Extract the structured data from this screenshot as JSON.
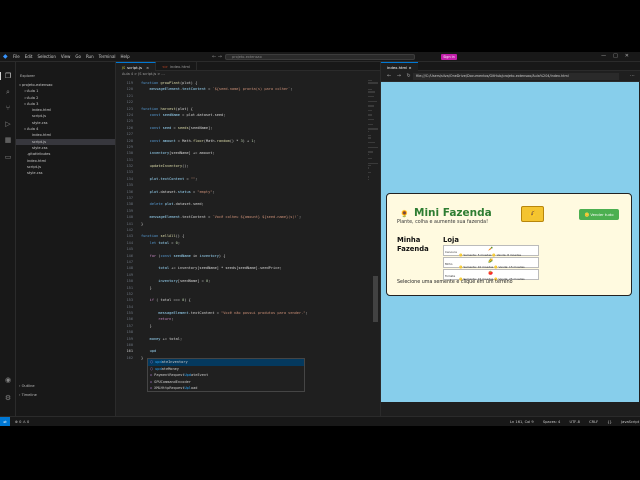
{
  "menubar": {
    "logo": "vscode-logo",
    "items": [
      "File",
      "Edit",
      "Selection",
      "View",
      "Go",
      "Run",
      "Terminal",
      "Help"
    ],
    "search_placeholder": "projeto-extensao",
    "signin": "Sign in"
  },
  "sidebar": {
    "title": "Explorer",
    "tree": [
      {
        "label": "projeto-extensao",
        "level": 0,
        "twisty": "v"
      },
      {
        "label": "Aula 1",
        "level": 1,
        "twisty": ">"
      },
      {
        "label": "Aula 2",
        "level": 1,
        "twisty": ">"
      },
      {
        "label": "Aula 3",
        "level": 1,
        "twisty": "v"
      },
      {
        "label": "index.html",
        "level": 2,
        "twisty": ""
      },
      {
        "label": "script.js",
        "level": 2,
        "twisty": ""
      },
      {
        "label": "style.css",
        "level": 2,
        "twisty": ""
      },
      {
        "label": "Aula 4",
        "level": 1,
        "twisty": "v"
      },
      {
        "label": "index.html",
        "level": 2,
        "twisty": ""
      },
      {
        "label": "script.js",
        "level": 2,
        "twisty": "",
        "selected": true
      },
      {
        "label": "style.css",
        "level": 2,
        "twisty": ""
      },
      {
        "label": ".gitattributes",
        "level": 1,
        "twisty": ""
      },
      {
        "label": "index.html",
        "level": 1,
        "twisty": ""
      },
      {
        "label": "script.js",
        "level": 1,
        "twisty": ""
      },
      {
        "label": "style.css",
        "level": 1,
        "twisty": ""
      }
    ],
    "outline": "Outline",
    "timeline": "Timeline"
  },
  "editor": {
    "tabs": [
      {
        "label": "script.js",
        "icon": "JS",
        "active": true
      },
      {
        "label": "index.html",
        "icon": "<>",
        "active": false
      }
    ],
    "breadcrumb": "Aula 4 > JS script.js > ...",
    "lines": [
      {
        "n": "119",
        "parts": [
          [
            "kw",
            "function "
          ],
          [
            "fn",
            "growPlant"
          ],
          [
            "tx",
            "(plot) {"
          ]
        ]
      },
      {
        "n": "120",
        "parts": [
          [
            "va",
            "    messageElement"
          ],
          [
            "tx",
            "."
          ],
          [
            "va",
            "textContent"
          ],
          [
            "tx",
            " = "
          ],
          [
            "st",
            "`${seed.name} pronta(s) para colher`"
          ],
          [
            "tx",
            ";"
          ]
        ]
      },
      {
        "n": "121",
        "parts": [
          [
            "tx",
            ""
          ]
        ]
      },
      {
        "n": "122",
        "parts": [
          [
            "tx",
            ""
          ]
        ]
      },
      {
        "n": "123",
        "parts": [
          [
            "kw",
            "function "
          ],
          [
            "fn",
            "harvest"
          ],
          [
            "tx",
            "(plot) {"
          ]
        ]
      },
      {
        "n": "124",
        "parts": [
          [
            "kw",
            "    const "
          ],
          [
            "va",
            "seedName"
          ],
          [
            "tx",
            " = plot.dataset.seed;"
          ]
        ]
      },
      {
        "n": "125",
        "parts": [
          [
            "tx",
            ""
          ]
        ]
      },
      {
        "n": "126",
        "parts": [
          [
            "kw",
            "    const "
          ],
          [
            "va",
            "seed"
          ],
          [
            "tx",
            " = "
          ],
          [
            "fn",
            "seeds"
          ],
          [
            "tx",
            "[seedName];"
          ]
        ]
      },
      {
        "n": "127",
        "parts": [
          [
            "tx",
            ""
          ]
        ]
      },
      {
        "n": "128",
        "parts": [
          [
            "kw",
            "    const "
          ],
          [
            "va",
            "amount"
          ],
          [
            "tx",
            " = Math."
          ],
          [
            "fn",
            "floor"
          ],
          [
            "tx",
            "(Math."
          ],
          [
            "fn",
            "random"
          ],
          [
            "tx",
            "() * "
          ],
          [
            "nu",
            "3"
          ],
          [
            "tx",
            ") + "
          ],
          [
            "nu",
            "1"
          ],
          [
            "tx",
            ";"
          ]
        ]
      },
      {
        "n": "129",
        "parts": [
          [
            "tx",
            ""
          ]
        ]
      },
      {
        "n": "130",
        "parts": [
          [
            "va",
            "    inventory"
          ],
          [
            "tx",
            "[seedName] += amount;"
          ]
        ]
      },
      {
        "n": "131",
        "parts": [
          [
            "tx",
            ""
          ]
        ]
      },
      {
        "n": "132",
        "parts": [
          [
            "fn",
            "    updateInventory"
          ],
          [
            "tx",
            "();"
          ]
        ]
      },
      {
        "n": "133",
        "parts": [
          [
            "tx",
            ""
          ]
        ]
      },
      {
        "n": "134",
        "parts": [
          [
            "va",
            "    plot"
          ],
          [
            "tx",
            "."
          ],
          [
            "va",
            "textContent"
          ],
          [
            "tx",
            " = "
          ],
          [
            "st",
            "\"\""
          ],
          [
            "tx",
            ";"
          ]
        ]
      },
      {
        "n": "135",
        "parts": [
          [
            "tx",
            ""
          ]
        ]
      },
      {
        "n": "136",
        "parts": [
          [
            "va",
            "    plot"
          ],
          [
            "tx",
            ".dataset."
          ],
          [
            "va",
            "status"
          ],
          [
            "tx",
            " = "
          ],
          [
            "st",
            "\"empty\""
          ],
          [
            "tx",
            ";"
          ]
        ]
      },
      {
        "n": "137",
        "parts": [
          [
            "tx",
            ""
          ]
        ]
      },
      {
        "n": "138",
        "parts": [
          [
            "kw",
            "    delete "
          ],
          [
            "va",
            "plot"
          ],
          [
            "tx",
            ".dataset.seed;"
          ]
        ]
      },
      {
        "n": "139",
        "parts": [
          [
            "tx",
            ""
          ]
        ]
      },
      {
        "n": "140",
        "parts": [
          [
            "va",
            "    messageElement"
          ],
          [
            "tx",
            ".textContent = "
          ],
          [
            "st",
            "`Você colheu ${amount} ${seed.name}(s)!`"
          ],
          [
            "tx",
            ";"
          ]
        ]
      },
      {
        "n": "141",
        "parts": [
          [
            "tx",
            "}"
          ]
        ]
      },
      {
        "n": "142",
        "parts": [
          [
            "tx",
            ""
          ]
        ]
      },
      {
        "n": "143",
        "parts": [
          [
            "kw",
            "function "
          ],
          [
            "fn",
            "sellAll"
          ],
          [
            "tx",
            "() {"
          ]
        ]
      },
      {
        "n": "144",
        "parts": [
          [
            "kw",
            "    let "
          ],
          [
            "va",
            "total"
          ],
          [
            "tx",
            " = "
          ],
          [
            "nu",
            "0"
          ],
          [
            "tx",
            ";"
          ]
        ]
      },
      {
        "n": "145",
        "parts": [
          [
            "tx",
            ""
          ]
        ]
      },
      {
        "n": "146",
        "parts": [
          [
            "cf",
            "    for "
          ],
          [
            "tx",
            "("
          ],
          [
            "kw",
            "const "
          ],
          [
            "va",
            "seedName"
          ],
          [
            "tx",
            " in "
          ],
          [
            "va",
            "inventory"
          ],
          [
            "tx",
            ") {"
          ]
        ]
      },
      {
        "n": "147",
        "parts": [
          [
            "tx",
            ""
          ]
        ]
      },
      {
        "n": "148",
        "parts": [
          [
            "va",
            "        total"
          ],
          [
            "tx",
            " += inventory[seedName] * seeds[seedName].seedPrice;"
          ]
        ]
      },
      {
        "n": "149",
        "parts": [
          [
            "tx",
            ""
          ]
        ]
      },
      {
        "n": "150",
        "parts": [
          [
            "va",
            "        inventory"
          ],
          [
            "tx",
            "[seedName] = "
          ],
          [
            "nu",
            "0"
          ],
          [
            "tx",
            ";"
          ]
        ]
      },
      {
        "n": "151",
        "parts": [
          [
            "tx",
            "    }"
          ]
        ]
      },
      {
        "n": "152",
        "parts": [
          [
            "tx",
            ""
          ]
        ]
      },
      {
        "n": "153",
        "parts": [
          [
            "cf",
            "    if "
          ],
          [
            "tx",
            "( total === "
          ],
          [
            "nu",
            "0"
          ],
          [
            "tx",
            ") {"
          ]
        ]
      },
      {
        "n": "154",
        "parts": [
          [
            "tx",
            ""
          ]
        ]
      },
      {
        "n": "155",
        "parts": [
          [
            "va",
            "        messageElement"
          ],
          [
            "tx",
            ".textContent = "
          ],
          [
            "st",
            "\"Você não possui produtos para vender.\""
          ],
          [
            "tx",
            ";"
          ]
        ]
      },
      {
        "n": "156",
        "parts": [
          [
            "cf",
            "        return"
          ],
          [
            "tx",
            ";"
          ]
        ]
      },
      {
        "n": "157",
        "parts": [
          [
            "tx",
            "    }"
          ]
        ]
      },
      {
        "n": "158",
        "parts": [
          [
            "tx",
            ""
          ]
        ]
      },
      {
        "n": "159",
        "parts": [
          [
            "va",
            "    money"
          ],
          [
            "tx",
            " += total;"
          ]
        ]
      },
      {
        "n": "160",
        "parts": [
          [
            "tx",
            ""
          ]
        ]
      },
      {
        "n": "161",
        "parts": [
          [
            "va",
            "    upd"
          ]
        ],
        "current": true
      },
      {
        "n": "162",
        "parts": [
          [
            "tx",
            "}"
          ]
        ]
      }
    ],
    "suggestions": [
      {
        "kind": "fn",
        "pre": "",
        "match": "upd",
        "post": "ateInventory",
        "selected": true
      },
      {
        "kind": "fn",
        "pre": "",
        "match": "upd",
        "post": "ateMoney",
        "selected": false
      },
      {
        "kind": "cls",
        "pre": "PaymentRequest",
        "match": "Upd",
        "post": "ateEvent",
        "selected": false
      },
      {
        "kind": "cls",
        "pre": "GPUCommandEncoder",
        "match": "",
        "post": "",
        "selected": false
      },
      {
        "kind": "cls",
        "pre": "XMLHttpRequest",
        "match": "Upl",
        "post": "oad",
        "selected": false
      }
    ]
  },
  "preview": {
    "tab": "index.html",
    "url": "file:///C:/Users/silva/OneDrive/Documentos/GitHub/projeto-extensao/Aula%204/index.html",
    "app": {
      "title": "Mini Fazenda",
      "subtitle": "Plante, colha e aumente sua fazenda!",
      "coin_icon": "coin-bag-icon",
      "sell_button": "Vender tudo",
      "my_farm": "Minha Fazenda",
      "shop_title": "Loja",
      "shop_items": [
        {
          "name": "Cenoura",
          "emoji": "🥕",
          "price": "🪙 Semente: 5 moedas 🪙 Venda: 8 moedas"
        },
        {
          "name": "Milho",
          "emoji": "🌽",
          "price": "🪙 Semente: 10 moedas 🪙 Venda: 15 moedas"
        },
        {
          "name": "Tomate",
          "emoji": "🍅",
          "price": "🪙 Semente: 15 moedas 🪙 Venda: 25 moedas"
        }
      ],
      "status": "Selecione uma semente e clique em um terreno"
    }
  },
  "statusbar": {
    "problems": "⊗ 0 ⚠ 0",
    "position": "Ln 161, Col 9",
    "spaces": "Spaces: 4",
    "encoding": "UTF-8",
    "eol": "CRLF",
    "language_mark": "{}",
    "language": "JavaScript"
  }
}
